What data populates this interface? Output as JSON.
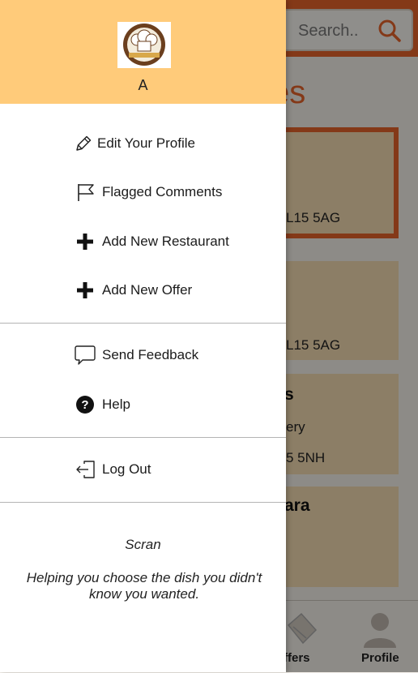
{
  "background": {
    "search_placeholder": "Search..",
    "heading_partial": "es",
    "cards": [
      {
        "postcode_partial": "L15 5AG"
      },
      {
        "postcode_partial": "L15 5AG"
      },
      {
        "title_partial": "s",
        "line_partial": "ery",
        "postcode_partial": "5 5NH"
      },
      {
        "title_partial": "ara"
      }
    ],
    "bottom_nav": {
      "offers_label_partial": "ffers",
      "profile_label": "Profile"
    }
  },
  "drawer": {
    "header": {
      "user_name": "A",
      "background_color": "#ffcb7a"
    },
    "menu": [
      {
        "label": "Edit Your Profile",
        "icon": "pencil-icon"
      },
      {
        "label": "Flagged Comments",
        "icon": "flag-icon"
      },
      {
        "label": "Add New Restaurant",
        "icon": "plus-icon"
      },
      {
        "label": "Add New Offer",
        "icon": "plus-icon"
      },
      {
        "label": "Send Feedback",
        "icon": "speech-bubble-icon"
      },
      {
        "label": "Help",
        "icon": "help-circle-icon"
      },
      {
        "label": "Log Out",
        "icon": "logout-icon"
      }
    ],
    "footer": {
      "app_name": "Scran",
      "tagline": "Helping you choose the dish you didn't know you wanted."
    }
  },
  "colors": {
    "accent": "#e4622a",
    "card": "#f2d9b0"
  }
}
